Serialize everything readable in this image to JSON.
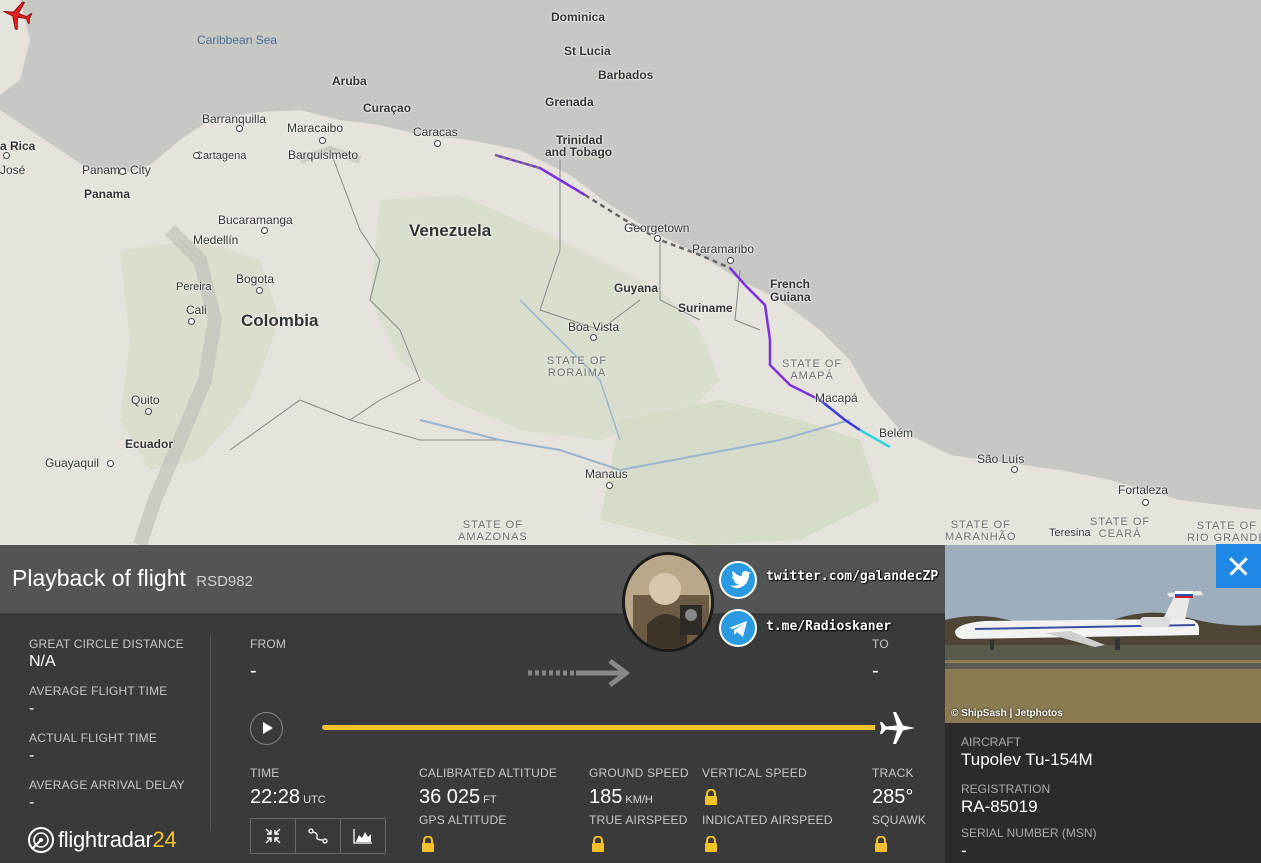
{
  "map": {
    "labels": {
      "caribbean_sea": "Caribbean Sea",
      "dominica": "Dominica",
      "st_lucia": "St Lucia",
      "barbados": "Barbados",
      "grenada": "Grenada",
      "aruba": "Aruba",
      "curacao": "Curaçao",
      "trinidad": "Trinidad",
      "and_tobago": "and Tobago",
      "barranquilla": "Barranquilla",
      "maracaibo": "Maracaibo",
      "caracas": "Caracas",
      "cartagena": "Cartagena",
      "barquisimeto": "Barquisimeto",
      "costa_rica": "a Rica",
      "san_jose": "José",
      "panama_city": "Panama City",
      "panama": "Panama",
      "venezuela": "Venezuela",
      "georgetown": "Georgetown",
      "paramaribo": "Paramaribo",
      "bucaramanga": "Bucaramanga",
      "medellin": "Medellín",
      "french": "French",
      "guiana": "Guiana",
      "bogota": "Bogota",
      "guyana": "Guyana",
      "suriname": "Suriname",
      "pereira": "Pereira",
      "cali": "Cali",
      "colombia": "Colombia",
      "boa_vista": "Boa Vista",
      "state_of_amapa_1": "STATE OF",
      "state_of_amapa_2": "AMAPÁ",
      "state_of_roraima_1": "STATE OF",
      "state_of_roraima_2": "RORAIMA",
      "macapa": "Macapá",
      "quito": "Quito",
      "ecuador": "Ecuador",
      "belem": "Belém",
      "guayaquil": "Guayaquil",
      "sao_luis": "São Luís",
      "manaus": "Manaus",
      "fortaleza": "Fortaleza",
      "state_of_amazonas_1": "STATE OF",
      "state_of_amazonas_2": "AMAZONAS",
      "state_of_maranhao_1": "STATE OF",
      "state_of_maranhao_2": "MARANHÃO",
      "teresina": "Teresina",
      "state_of_ceara_1": "STATE OF",
      "state_of_ceara_2": "CEARÁ",
      "state_of_rgn_1": "STATE OF",
      "state_of_rgn_2": "RIO GRANDE"
    }
  },
  "colors": {
    "accent_yellow": "#f6c22c",
    "track_purple": "#7b2fe0",
    "track_cyan": "#2fd3e0",
    "close_blue": "#1e88e5",
    "plane_red": "#e02020"
  },
  "panel": {
    "title": "Playback of flight",
    "callsign": "RSD982",
    "great_circle_label": "GREAT CIRCLE DISTANCE",
    "great_circle_value": "N/A",
    "avg_flight_time_label": "AVERAGE FLIGHT TIME",
    "avg_flight_time_value": "-",
    "actual_flight_time_label": "ACTUAL FLIGHT TIME",
    "actual_flight_time_value": "-",
    "avg_arrival_delay_label": "AVERAGE ARRIVAL DELAY",
    "avg_arrival_delay_value": "-",
    "from_label": "FROM",
    "from_value": "-",
    "to_label": "TO",
    "to_value": "-",
    "playback_progress": 1.0,
    "time_label": "TIME",
    "time_value": "22:28",
    "time_unit": "UTC",
    "cal_alt_label": "CALIBRATED ALTITUDE",
    "cal_alt_value": "36 025",
    "cal_alt_unit": "FT",
    "gps_alt_label": "GPS ALTITUDE",
    "ground_speed_label": "GROUND SPEED",
    "ground_speed_value": "185",
    "ground_speed_unit": "KM/H",
    "true_airspeed_label": "TRUE AIRSPEED",
    "vertical_speed_label": "VERTICAL SPEED",
    "indicated_airspeed_label": "INDICATED AIRSPEED",
    "track_label": "TRACK",
    "track_value": "285°",
    "squawk_label": "SQUAWK",
    "tools": [
      "collapse-icon",
      "route-icon",
      "chart-icon"
    ]
  },
  "social": {
    "twitter": "twitter.com/galandecZP",
    "telegram": "t.me/Radioskaner"
  },
  "logo": {
    "text": "flightradar",
    "number": "24"
  },
  "aircraft": {
    "photo_credit": "© ShipSash | Jetphotos",
    "aircraft_label": "AIRCRAFT",
    "aircraft_value": "Tupolev Tu-154M",
    "registration_label": "REGISTRATION",
    "registration_value": "RA-85019",
    "serial_label": "SERIAL NUMBER (MSN)",
    "serial_value": "-"
  }
}
